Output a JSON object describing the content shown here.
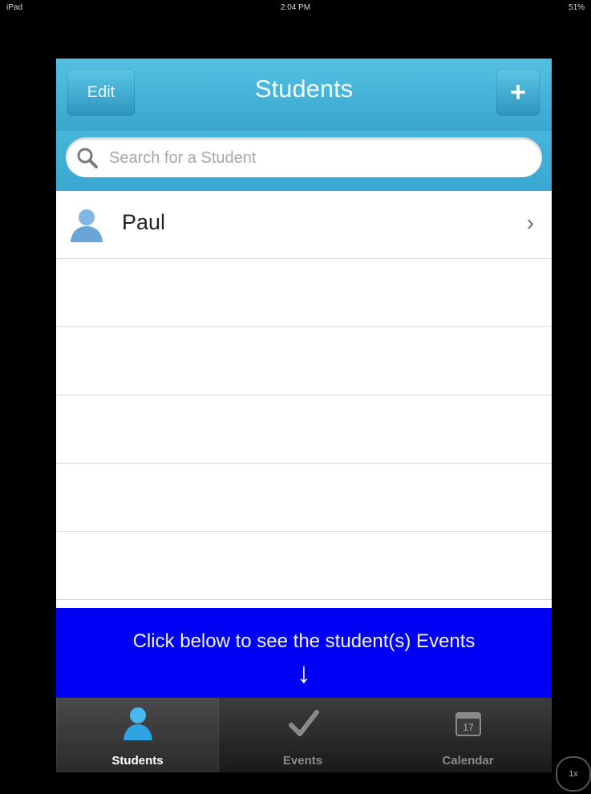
{
  "status_bar": {
    "left": "iPad",
    "time": "2:04 PM",
    "battery": "51%"
  },
  "header": {
    "edit_label": "Edit",
    "title": "Students",
    "add_label": "+"
  },
  "search": {
    "placeholder": "Search for a Student"
  },
  "students": {
    "items": [
      {
        "name": "Paul"
      }
    ]
  },
  "banner": {
    "text": "Click below to see the student(s) Events",
    "arrow": "↓"
  },
  "tabs": [
    {
      "label": "Students",
      "icon": "person-icon",
      "selected": true
    },
    {
      "label": "Events",
      "icon": "checkmark-icon",
      "selected": false
    },
    {
      "label": "Calendar",
      "icon": "calendar-icon",
      "date": "17",
      "selected": false
    }
  ],
  "zoom_badge": "1x",
  "colors": {
    "nav": "#3aa6cf",
    "banner": "#0000f5",
    "tabbar": "#2a2a2a"
  }
}
